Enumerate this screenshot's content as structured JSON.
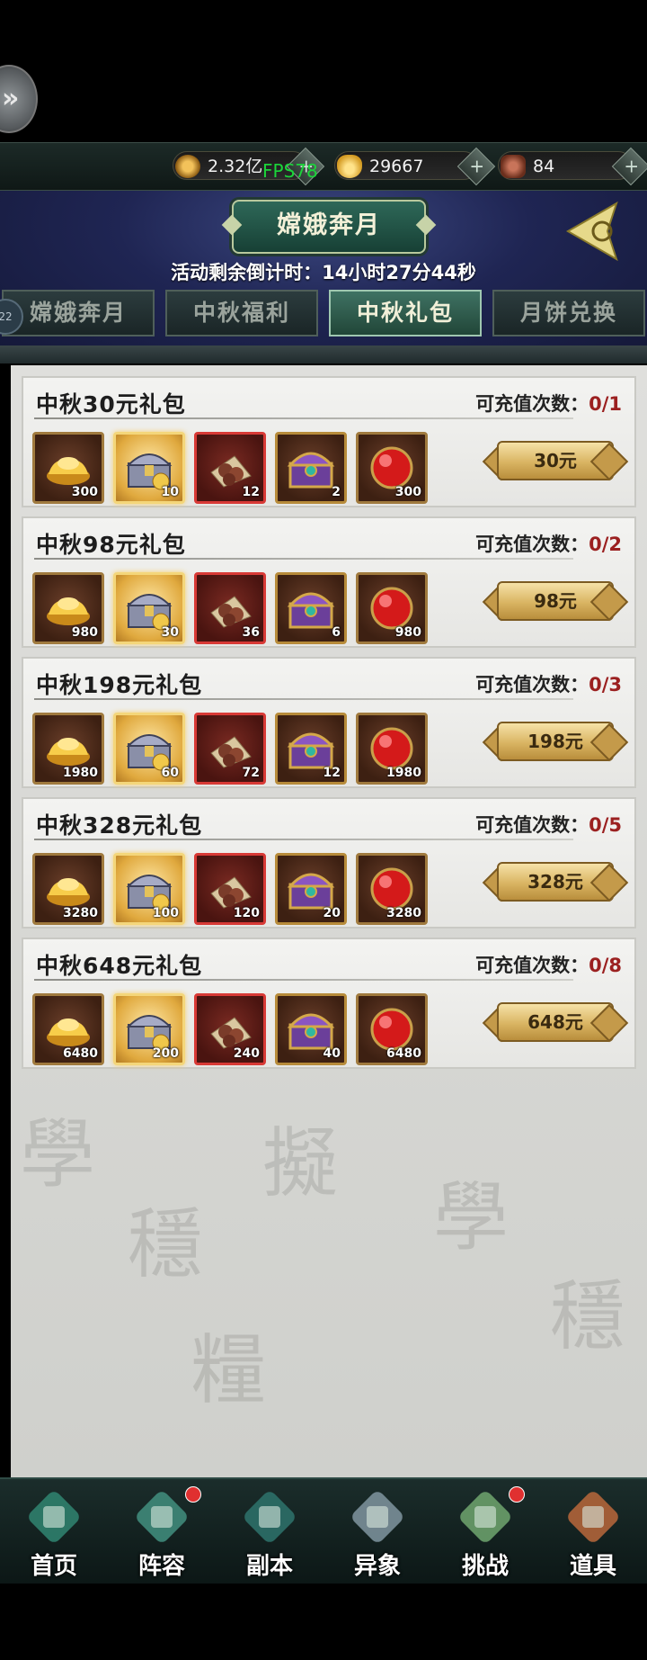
{
  "currency": {
    "copper": {
      "value": "2.32亿",
      "icon": "coin-icon"
    },
    "gold": {
      "value": "29667",
      "icon": "gold-ingot-icon"
    },
    "other": {
      "value": "84",
      "icon": "pouch-icon"
    }
  },
  "fps": "FPS78",
  "header": {
    "title": "嫦娥奔月",
    "countdown": "活动剩余倒计时：14小时27分44秒"
  },
  "tabs": [
    {
      "label": "嫦娥奔月"
    },
    {
      "label": "中秋福利"
    },
    {
      "label": "中秋礼包"
    },
    {
      "label": "月饼兑换"
    }
  ],
  "tab_badge": "22",
  "packs": [
    {
      "title": "中秋30元礼包",
      "limit_label": "可充值次数：",
      "limit_value": "0/1",
      "price": "30元",
      "items": [
        "300",
        "10",
        "12",
        "2",
        "300"
      ]
    },
    {
      "title": "中秋98元礼包",
      "limit_label": "可充值次数：",
      "limit_value": "0/2",
      "price": "98元",
      "items": [
        "980",
        "30",
        "36",
        "6",
        "980"
      ]
    },
    {
      "title": "中秋198元礼包",
      "limit_label": "可充值次数：",
      "limit_value": "0/3",
      "price": "198元",
      "items": [
        "1980",
        "60",
        "72",
        "12",
        "1980"
      ]
    },
    {
      "title": "中秋328元礼包",
      "limit_label": "可充值次数：",
      "limit_value": "0/5",
      "price": "328元",
      "items": [
        "3280",
        "100",
        "120",
        "20",
        "3280"
      ]
    },
    {
      "title": "中秋648元礼包",
      "limit_label": "可充值次数：",
      "limit_value": "0/8",
      "price": "648元",
      "items": [
        "6480",
        "200",
        "240",
        "40",
        "6480"
      ]
    }
  ],
  "item_types": [
    "gold-ingot-icon",
    "treasure-chest-icon",
    "pills-icon",
    "purple-chest-icon",
    "red-orb-icon"
  ],
  "nav": [
    {
      "label": "首页",
      "icon": "home-icon"
    },
    {
      "label": "阵容",
      "icon": "lineup-icon"
    },
    {
      "label": "副本",
      "icon": "dungeon-icon"
    },
    {
      "label": "异象",
      "icon": "crossed-swords-icon"
    },
    {
      "label": "挑战",
      "icon": "scroll-map-icon"
    },
    {
      "label": "道具",
      "icon": "bag-icon"
    }
  ]
}
